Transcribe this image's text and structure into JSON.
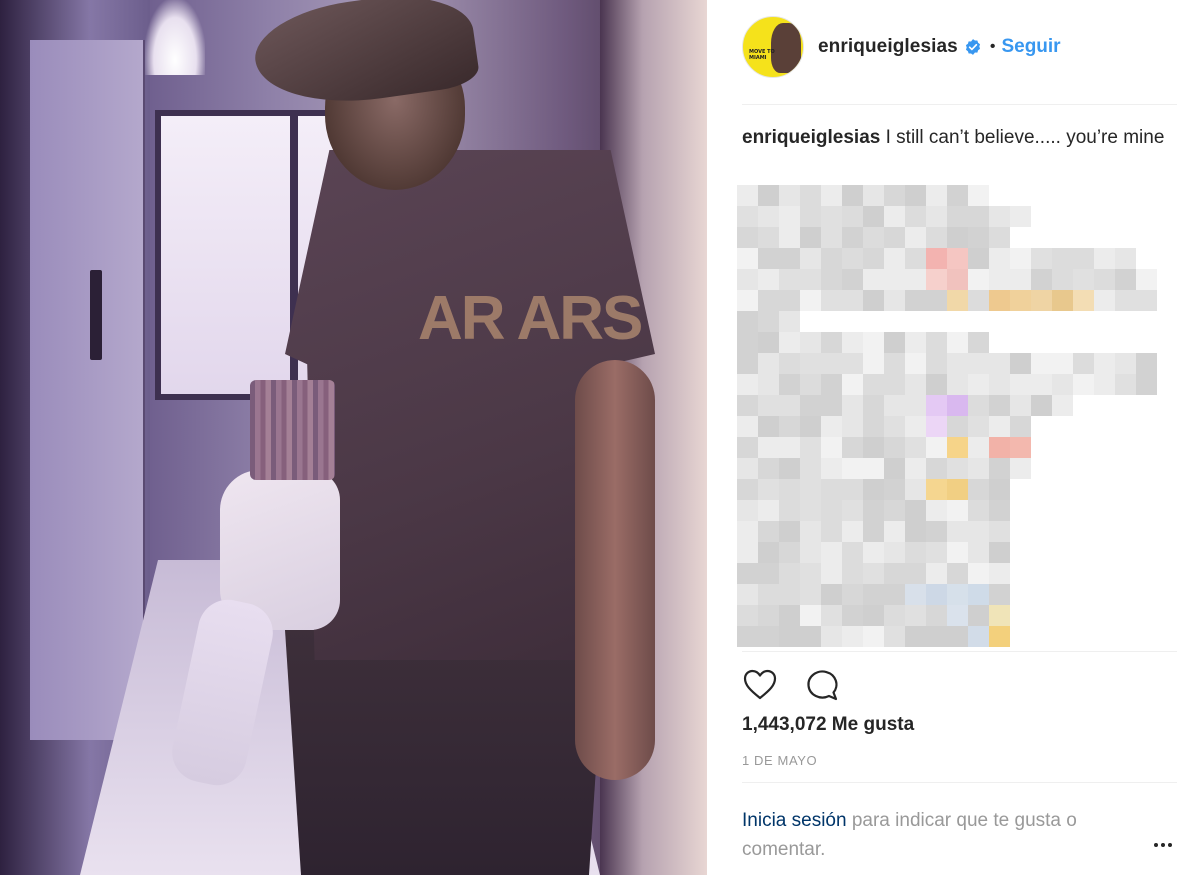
{
  "post": {
    "author": {
      "username": "enriqueiglesias",
      "verified": true,
      "avatar_text": "MOVE TO MIAMI"
    },
    "follow_label": "Seguir",
    "separator": "•",
    "caption": {
      "username": "enriqueiglesias",
      "text": "I still can’t believe..... you’re mine"
    },
    "hidden_comments": "pixelated / blurred comments",
    "actions": {
      "like_icon": "heart-icon",
      "comment_icon": "comment-icon"
    },
    "likes": "1,443,072 Me gusta",
    "date": "1 DE MAYO",
    "login_prompt": {
      "link": "Inicia sesión",
      "text": "para indicar que te gusta o comentar."
    },
    "more_icon": "more-options-icon"
  },
  "photo": {
    "shirt_print": "AR ARS"
  },
  "colors": {
    "accent": "#3897f0",
    "link_dark": "#003569",
    "text": "#262626",
    "muted": "#999999",
    "verified_badge": "#3897f0",
    "avatar_bg": "#f5e21b"
  }
}
